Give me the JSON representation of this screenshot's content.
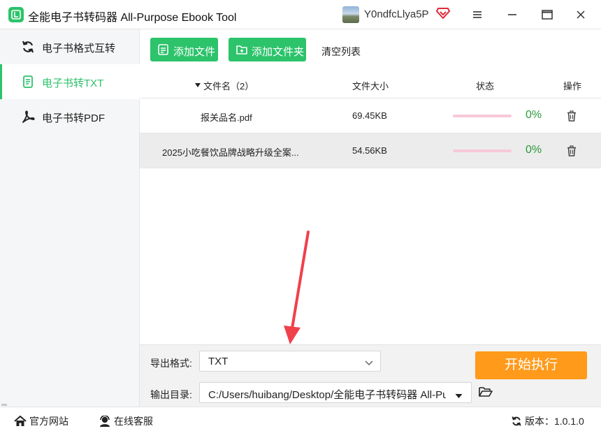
{
  "window": {
    "title": "全能电子书转码器 All-Purpose Ebook Tool",
    "user_name": "Y0ndfcLlya5P"
  },
  "sidebar": {
    "items": [
      {
        "label": "电子书格式互转",
        "icon": "refresh-icon",
        "active": false
      },
      {
        "label": "电子书转TXT",
        "icon": "document-icon",
        "active": true
      },
      {
        "label": "电子书转PDF",
        "icon": "pdf-icon",
        "active": false
      }
    ]
  },
  "toolbar": {
    "add_file_label": "添加文件",
    "add_folder_label": "添加文件夹",
    "clear_label": "清空列表"
  },
  "table": {
    "columns": {
      "name": "文件名（2）",
      "size": "文件大小",
      "status": "状态",
      "action": "操作"
    },
    "rows": [
      {
        "name": "报关品名.pdf",
        "size": "69.45KB",
        "progress": 0,
        "progress_text": "0%"
      },
      {
        "name": "2025小吃餐饮品牌战略升级全案...",
        "size": "54.56KB",
        "progress": 0,
        "progress_text": "0%"
      }
    ]
  },
  "bottom": {
    "format_label": "导出格式:",
    "format_value": "TXT",
    "output_label": "输出目录:",
    "output_value": "C:/Users/huibang/Desktop/全能电子书转码器 All-Pu",
    "start_label": "开始执行"
  },
  "statusbar": {
    "website_label": "官方网站",
    "service_label": "在线客服",
    "version_label": "版本：1.0.1.0"
  },
  "colors": {
    "accent": "#2cc36b",
    "start_button": "#ff9a1a",
    "progress_track": "#f7c9d6",
    "percent_text": "#2a9a3a",
    "arrow": "#f0404a"
  }
}
